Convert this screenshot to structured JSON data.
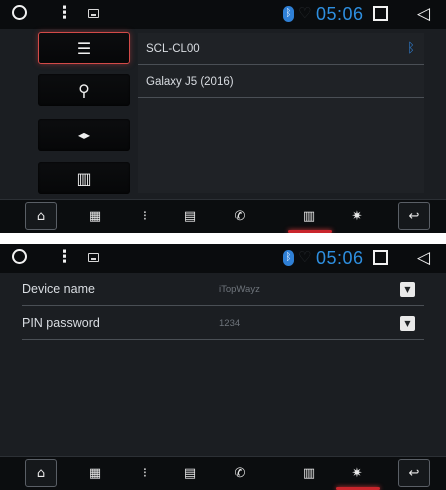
{
  "top": {
    "status": {
      "time": "05:06"
    },
    "sidebar": [
      {
        "name": "list-icon",
        "glyph": "☰",
        "active": true
      },
      {
        "name": "search-icon",
        "glyph": "⚲",
        "active": false
      },
      {
        "name": "pair-icon",
        "glyph": "◂▸",
        "active": false
      },
      {
        "name": "trash-icon",
        "glyph": "🗑",
        "active": false
      }
    ],
    "devices": [
      {
        "label": "SCL-CL00",
        "bluetooth": true
      },
      {
        "label": "Galaxy J5 (2016)",
        "bluetooth": false
      }
    ]
  },
  "bottom": {
    "status": {
      "time": "05:06"
    },
    "settings": [
      {
        "label": "Device name",
        "value": "iTopWayz"
      },
      {
        "label": "PIN password",
        "value": "1234"
      }
    ]
  },
  "nav": {
    "items": [
      {
        "name": "home-icon",
        "glyph": "⌂"
      },
      {
        "name": "dialpad-icon",
        "glyph": "▦"
      },
      {
        "name": "call-log-icon",
        "glyph": "⁝"
      },
      {
        "name": "contacts-icon",
        "glyph": "▤"
      },
      {
        "name": "phone-icon",
        "glyph": "✆"
      },
      {
        "name": "bt-music-icon",
        "glyph": "▥"
      },
      {
        "name": "settings-icon",
        "glyph": "✷"
      },
      {
        "name": "back-icon",
        "glyph": "↩"
      }
    ],
    "top_active": "bt-music-icon",
    "bottom_active": "settings-icon"
  },
  "colors": {
    "accent_blue": "#2e8fe0",
    "highlight_red": "#c9252b",
    "panel_bg": "#1b1e22"
  }
}
